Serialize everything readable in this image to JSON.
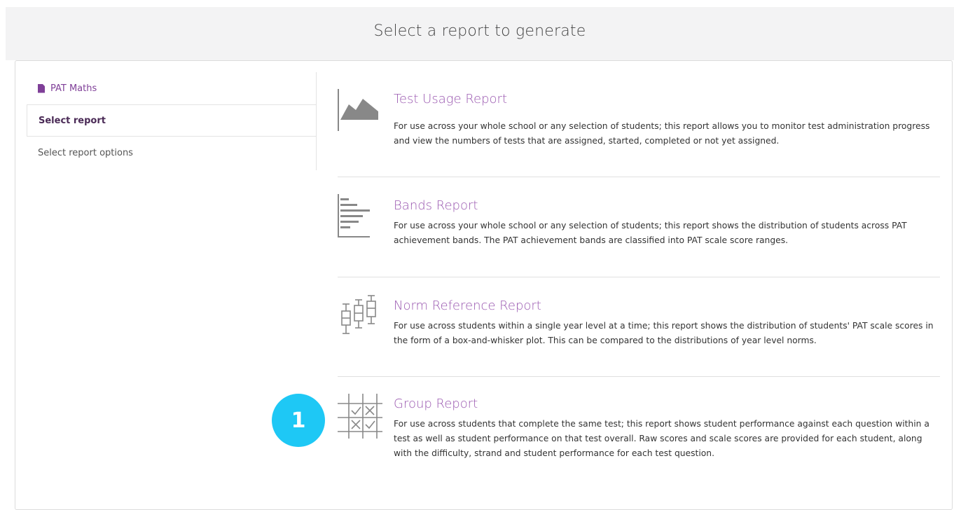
{
  "header": {
    "title": "Select a report to generate"
  },
  "nav": {
    "product": "PAT Maths",
    "items": [
      {
        "label": "Select report",
        "active": true
      },
      {
        "label": "Select report options",
        "active": false
      }
    ]
  },
  "reports": [
    {
      "icon": "area-chart-icon",
      "title": "Test Usage Report",
      "description": "For use across your whole school or any selection of students; this report allows you to monitor test administration progress and view the numbers of tests that are assigned, started, completed or not yet assigned."
    },
    {
      "icon": "bar-chart-icon",
      "title": "Bands Report",
      "description": "For use across your whole school or any selection of students; this report shows the distribution of students across PAT achievement bands. The PAT achievement bands are classified into PAT scale score ranges."
    },
    {
      "icon": "box-plot-icon",
      "title": "Norm Reference Report",
      "description": "For use across students within a single year level at a time; this report shows the distribution of students' PAT scale scores in the form of a box-and-whisker plot. This can be compared to the distributions of year level norms."
    },
    {
      "icon": "grid-check-icon",
      "title": "Group Report",
      "description": "For use across students that complete the same test; this report shows student performance against each question within a test as well as student performance on that test overall. Raw scores and scale scores are provided for each student, along with the difficulty, strand and student performance for each test question."
    }
  ],
  "callout": {
    "number": "1",
    "color": "#1ec8f5"
  },
  "colors": {
    "accent": "#9a58b0",
    "nav_product": "#7f3f98",
    "icon": "#888888"
  }
}
